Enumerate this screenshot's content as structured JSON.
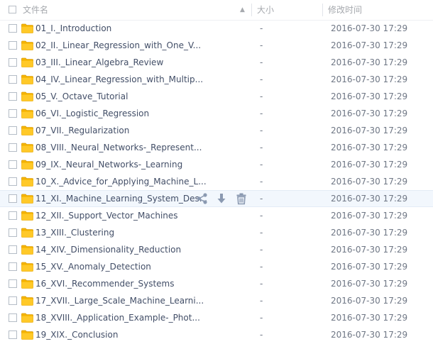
{
  "header": {
    "name_label": "文件名",
    "size_label": "大小",
    "time_label": "修改时间"
  },
  "icons": {
    "folder": "folder-icon",
    "share": "share-icon",
    "download": "download-icon",
    "delete": "trash-icon",
    "sort": "sort-arrow-icon"
  },
  "colors": {
    "folder": "#f5b800",
    "hover_row": "#f2f7fd",
    "text": "#424e67",
    "muted": "#6f7785",
    "action_icon": "#8a99b1"
  },
  "rows": [
    {
      "name": "01_I._Introduction",
      "size": "-",
      "time": "2016-07-30 17:29"
    },
    {
      "name": "02_II._Linear_Regression_with_One_V...",
      "size": "-",
      "time": "2016-07-30 17:29"
    },
    {
      "name": "03_III._Linear_Algebra_Review",
      "size": "-",
      "time": "2016-07-30 17:29"
    },
    {
      "name": "04_IV._Linear_Regression_with_Multip...",
      "size": "-",
      "time": "2016-07-30 17:29"
    },
    {
      "name": "05_V._Octave_Tutorial",
      "size": "-",
      "time": "2016-07-30 17:29"
    },
    {
      "name": "06_VI._Logistic_Regression",
      "size": "-",
      "time": "2016-07-30 17:29"
    },
    {
      "name": "07_VII._Regularization",
      "size": "-",
      "time": "2016-07-30 17:29"
    },
    {
      "name": "08_VIII._Neural_Networks-_Represent...",
      "size": "-",
      "time": "2016-07-30 17:29"
    },
    {
      "name": "09_IX._Neural_Networks-_Learning",
      "size": "-",
      "time": "2016-07-30 17:29"
    },
    {
      "name": "10_X._Advice_for_Applying_Machine_L...",
      "size": "-",
      "time": "2016-07-30 17:29"
    },
    {
      "name": "11_XI._Machine_Learning_System_Des...",
      "size": "-",
      "time": "2016-07-30 17:29",
      "hover": true
    },
    {
      "name": "12_XII._Support_Vector_Machines",
      "size": "-",
      "time": "2016-07-30 17:29"
    },
    {
      "name": "13_XIII._Clustering",
      "size": "-",
      "time": "2016-07-30 17:29"
    },
    {
      "name": "14_XIV._Dimensionality_Reduction",
      "size": "-",
      "time": "2016-07-30 17:29"
    },
    {
      "name": "15_XV._Anomaly_Detection",
      "size": "-",
      "time": "2016-07-30 17:29"
    },
    {
      "name": "16_XVI._Recommender_Systems",
      "size": "-",
      "time": "2016-07-30 17:29"
    },
    {
      "name": "17_XVII._Large_Scale_Machine_Learni...",
      "size": "-",
      "time": "2016-07-30 17:29"
    },
    {
      "name": "18_XVIII._Application_Example-_Phot...",
      "size": "-",
      "time": "2016-07-30 17:29"
    },
    {
      "name": "19_XIX._Conclusion",
      "size": "-",
      "time": "2016-07-30 17:29"
    }
  ]
}
